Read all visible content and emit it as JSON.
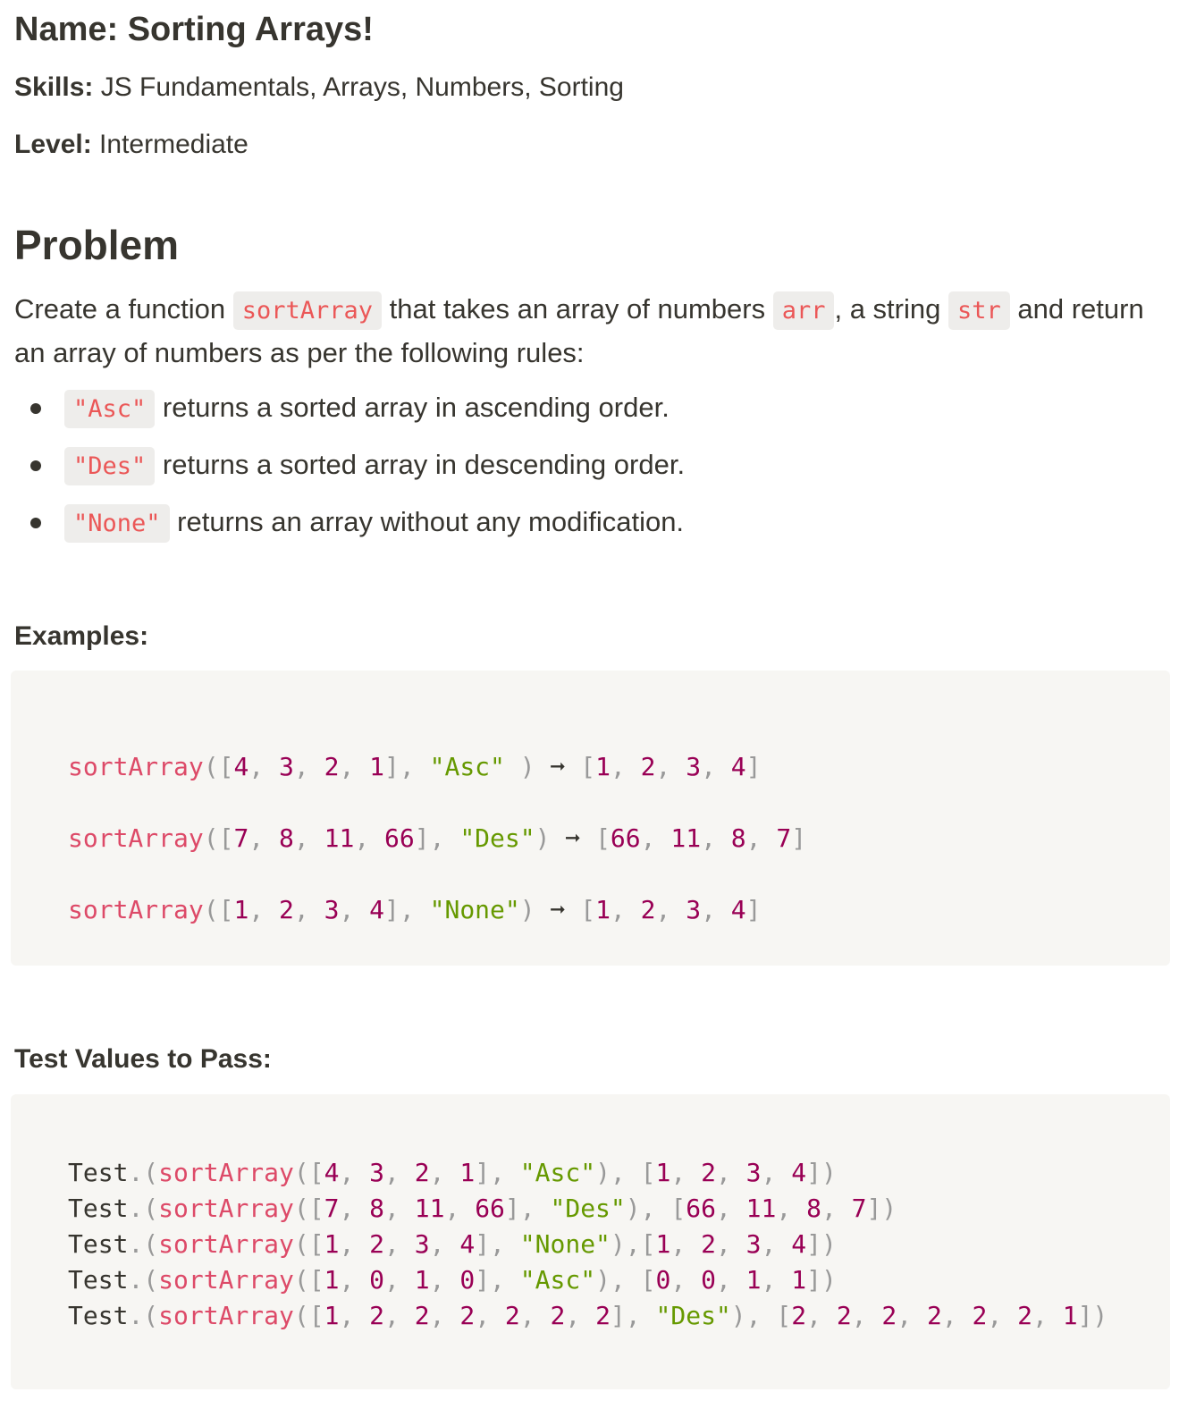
{
  "header": {
    "name": "Name: Sorting Arrays!",
    "skills_label": "Skills:",
    "skills_value": " JS Fundamentals, Arrays, Numbers, Sorting",
    "level_label": "Level:",
    "level_value": " Intermediate"
  },
  "problem": {
    "title": "Problem",
    "text_1": "Create a function ",
    "code_fn": "sortArray",
    "text_2": " that takes an array of numbers ",
    "code_arr": "arr",
    "text_3": ", a string ",
    "code_str": "str",
    "text_4": " and return an array of numbers as per the following rules:",
    "rules": [
      {
        "code": "\"Asc\"",
        "text": " returns a sorted array in ascending order."
      },
      {
        "code": "\"Des\"",
        "text": " returns a sorted array in descending order."
      },
      {
        "code": "\"None\"",
        "text": " returns an array without any modification."
      }
    ]
  },
  "examples": {
    "label": "Examples:",
    "lines": [
      "sortArray([4, 3, 2, 1], \"Asc\" ) ➞ [1, 2, 3, 4]",
      "sortArray([7, 8, 11, 66], \"Des\") ➞ [66, 11, 8, 7]",
      "sortArray([1, 2, 3, 4], \"None\") ➞ [1, 2, 3, 4]"
    ]
  },
  "tests": {
    "label": "Test Values to Pass:",
    "lines": [
      "Test.(sortArray([4, 3, 2, 1], \"Asc\"), [1, 2, 3, 4])",
      "Test.(sortArray([7, 8, 11, 66], \"Des\"), [66, 11, 8, 7])",
      "Test.(sortArray([1, 2, 3, 4], \"None\"),[1, 2, 3, 4])",
      "Test.(sortArray([1, 0, 1, 0], \"Asc\"), [0, 0, 1, 1])",
      "Test.(sortArray([1, 2, 2, 2, 2, 2, 2], \"Des\"), [2, 2, 2, 2, 2, 2, 1])"
    ]
  },
  "syntax_colors": {
    "function": "#dd4a68",
    "punctuation": "#999999",
    "number": "#990055",
    "string": "#669900",
    "inline_code": "#eb5757",
    "code_background": "#f7f6f3"
  }
}
